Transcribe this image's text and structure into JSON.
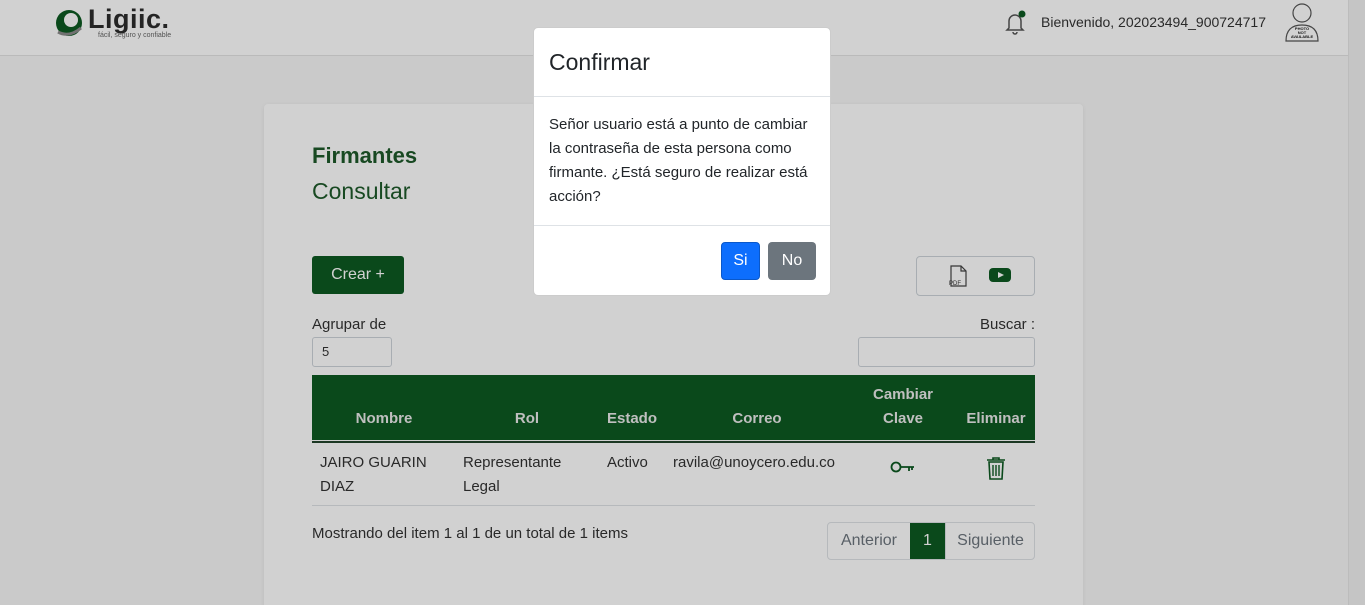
{
  "header": {
    "logo_text": "Ligiic.",
    "logo_tagline": "fácil, seguro y confiable",
    "welcome": "Bienvenido, 202023494_900724717",
    "avatar_label": "PHOTO NOT AVAILABLE"
  },
  "page": {
    "title": "Firmantes",
    "subtitle": "Consultar",
    "create_button": "Crear +",
    "group_label": "Agrupar de",
    "group_value": "5",
    "search_label": "Buscar :",
    "search_value": ""
  },
  "table": {
    "headers": [
      "Nombre",
      "Rol",
      "Estado",
      "Correo",
      "Cambiar Clave",
      "Eliminar"
    ],
    "header_cambiar_1": "Cambiar",
    "header_cambiar_2": "Clave",
    "rows": [
      {
        "nombre": "JAIRO GUARIN DIAZ",
        "nombre_l1": "JAIRO GUARIN",
        "nombre_l2": "DIAZ",
        "rol_l1": "Representante",
        "rol_l2": "Legal",
        "estado": "Activo",
        "correo": "ravila@unoycero.edu.co"
      }
    ]
  },
  "pagination": {
    "info": "Mostrando del item 1 al 1 de un total de 1 items",
    "prev": "Anterior",
    "current": "1",
    "next": "Siguiente"
  },
  "modal": {
    "title": "Confirmar",
    "body": "Señor usuario está a punto de cambiar la contraseña de esta persona como firmante. ¿Está seguro de realizar está acción?",
    "yes": "Si",
    "no": "No"
  },
  "colors": {
    "brand_green": "#0d5a22",
    "primary_blue": "#0d6efd",
    "secondary_gray": "#6c757d"
  },
  "icons": [
    "bell-icon",
    "avatar-icon",
    "pdf-icon",
    "youtube-icon",
    "key-icon",
    "trash-icon"
  ]
}
